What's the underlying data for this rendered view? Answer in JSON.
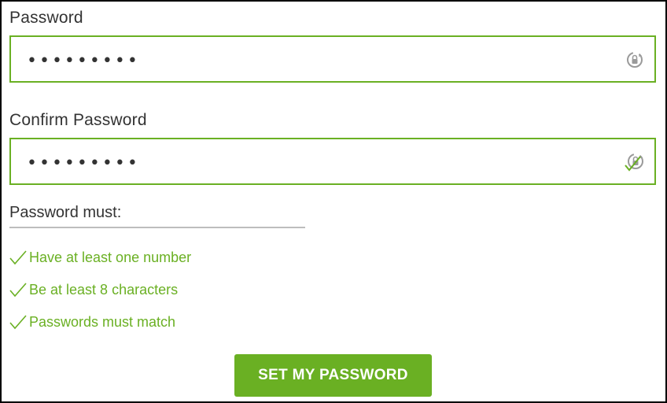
{
  "colors": {
    "accent": "#6ab023",
    "text": "#333333",
    "icon_gray": "#9a9a9a"
  },
  "password": {
    "label": "Password",
    "value_masked": "•••••••••",
    "icon": "reveal-password-icon"
  },
  "confirm_password": {
    "label": "Confirm Password",
    "value_masked": "•••••••••",
    "icon": "password-match-check-icon"
  },
  "requirements": {
    "title": "Password must:",
    "items": [
      {
        "label": "Have at least one number",
        "met": true
      },
      {
        "label": "Be at least 8 characters",
        "met": true
      },
      {
        "label": "Passwords must match",
        "met": true
      }
    ]
  },
  "submit": {
    "label": "SET MY PASSWORD"
  }
}
